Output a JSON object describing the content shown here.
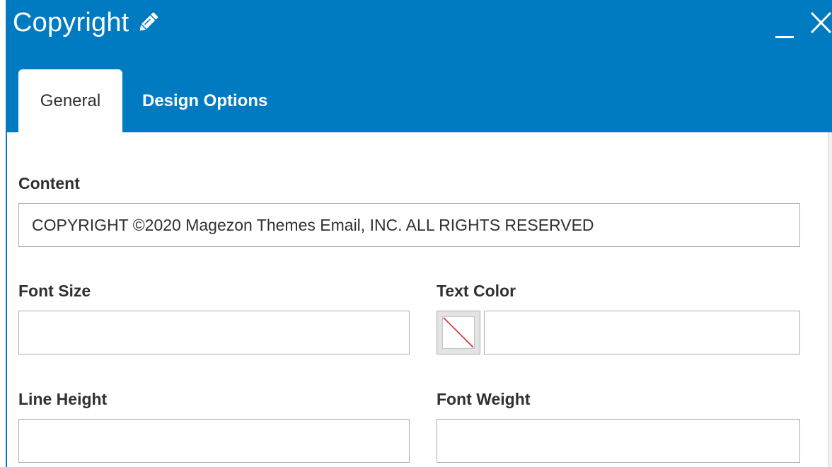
{
  "modal": {
    "title": "Copyright",
    "title_icon": "pencil-icon",
    "minimize_icon": "minimize-icon",
    "close_icon": "close-icon",
    "header_color": "#007bc2"
  },
  "tabs": [
    {
      "label": "General",
      "active": true
    },
    {
      "label": "Design Options",
      "active": false
    }
  ],
  "form": {
    "content": {
      "label": "Content",
      "value": "COPYRIGHT ©2020 Magezon Themes Email, INC. ALL RIGHTS RESERVED"
    },
    "font_size": {
      "label": "Font Size",
      "value": ""
    },
    "text_color": {
      "label": "Text Color",
      "value": "",
      "swatch": "no-color"
    },
    "line_height": {
      "label": "Line Height",
      "value": ""
    },
    "font_weight": {
      "label": "Font Weight",
      "value": ""
    }
  }
}
